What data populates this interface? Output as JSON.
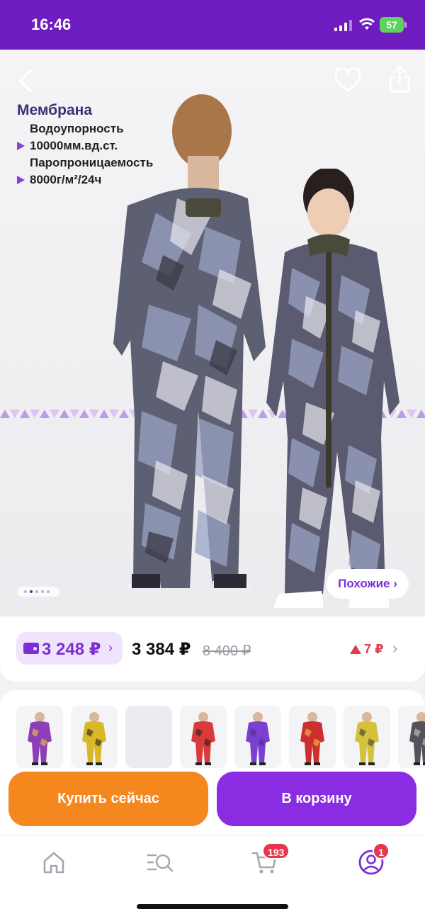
{
  "status_bar": {
    "time": "16:46",
    "battery": "57"
  },
  "product_image": {
    "feature_title": "Мембрана",
    "feature_lines": [
      "Водоупорность",
      "10000мм.вд.ст.",
      "Паропроницаемость",
      "8000г/м²/24ч"
    ],
    "similar_label": "Похожие ›",
    "pager": {
      "total": 5,
      "active": 2
    }
  },
  "price": {
    "wallet_price": "3 248 ₽",
    "wallet_chevron": "›",
    "current_price": "3 384 ₽",
    "old_price": "8 400 ₽",
    "trend_value": "7 ₽",
    "chevron": "›"
  },
  "variants": [
    {
      "name": "purple",
      "color": "#8e3fb8",
      "accent": "#f0c43a"
    },
    {
      "name": "yellow-black",
      "color": "#d8b826",
      "accent": "#222222"
    },
    {
      "name": "empty",
      "color": "#ececf0",
      "accent": "#ececf0"
    },
    {
      "name": "red-pair",
      "color": "#d93a3a",
      "accent": "#222222"
    },
    {
      "name": "purple-explorer",
      "color": "#7b3fd1",
      "accent": "#4a2f8a"
    },
    {
      "name": "red-trio",
      "color": "#cc2f2f",
      "accent": "#f0c43a"
    },
    {
      "name": "yellow-pair",
      "color": "#d5c23a",
      "accent": "#3c3c3c"
    },
    {
      "name": "camo",
      "color": "#55525c",
      "accent": "#c9c9d1"
    }
  ],
  "actions": {
    "buy_now": "Купить сейчас",
    "add_to_cart": "В корзину"
  },
  "tab_bar": {
    "items": [
      "home-icon",
      "catalog-search-icon",
      "cart-icon",
      "profile-icon"
    ],
    "cart_badge": "193",
    "profile_badge": "1",
    "accent": "#7a2fd6"
  },
  "colors": {
    "brand": "#6e1bbf",
    "buy": "#f5871f",
    "cart": "#8a2de2",
    "sale": "#e43a4a"
  }
}
